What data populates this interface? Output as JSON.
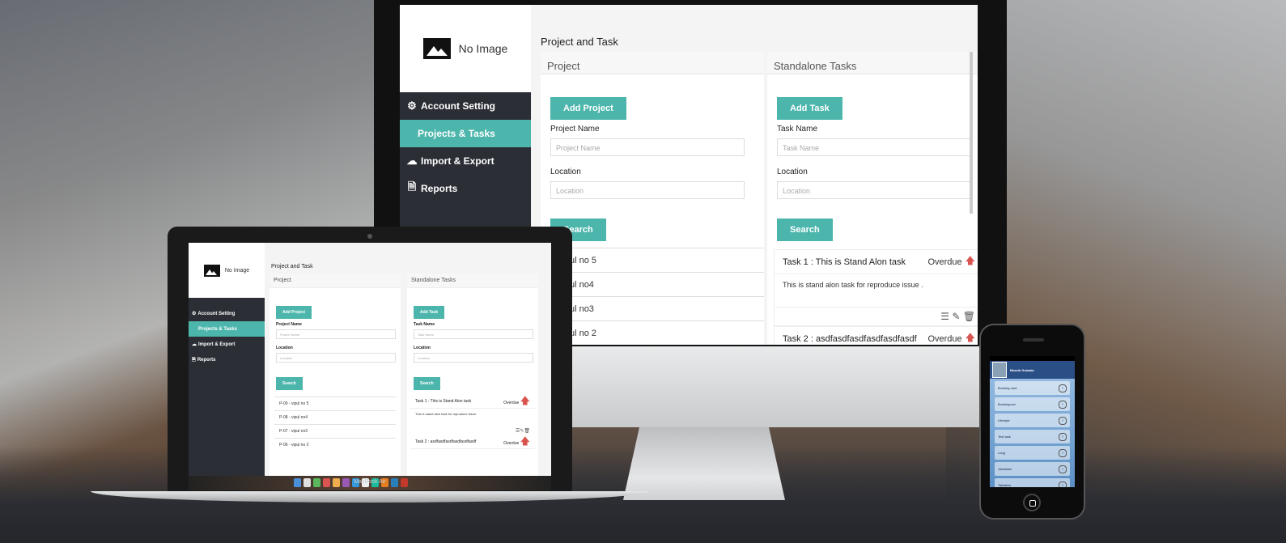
{
  "app": {
    "logo_text": "No Image",
    "page_title": "Project and Task",
    "nav": [
      {
        "label": "Account Setting",
        "icon": "gear-icon"
      },
      {
        "label": "Projects & Tasks",
        "icon": "",
        "active": true
      },
      {
        "label": "Import & Export",
        "icon": "cloud-upload-icon"
      },
      {
        "label": "Reports",
        "icon": "document-icon"
      }
    ],
    "project_panel": {
      "title": "Project",
      "add_button": "Add Project",
      "name_label": "Project Name",
      "name_placeholder": "Project Name",
      "location_label": "Location",
      "location_placeholder": "Location",
      "search_button": "Search",
      "rows": [
        "9 - vipul no 5",
        "8 - vipul no4",
        "7 - vipul no3",
        "6 - vipul no 2"
      ]
    },
    "task_panel": {
      "title": "Standalone Tasks",
      "add_button": "Add Task",
      "name_label": "Task Name",
      "name_placeholder": "Task Name",
      "location_label": "Location",
      "location_placeholder": "Location",
      "search_button": "Search",
      "tasks": [
        {
          "title": "Task 1 : This is Stand Alon task",
          "status": "Overdue",
          "body": "This is stand alon task for reproduce issue ."
        },
        {
          "title": "Task 2 : asdfasdfasdfasdfasdfasdf",
          "status": "Overdue",
          "body": ""
        }
      ]
    }
  },
  "laptop": {
    "label": "MacBook Air",
    "project_rows": [
      "P-09 - vipul no 5",
      "P-08 - vipul no4",
      "P-07 - vipul no3",
      "P-06 - vipul no 2"
    ],
    "task_titles": [
      "Task 1 : This is Stand Alon task",
      "Task 2 : asdfasdfasdfasdfasdfasdf"
    ],
    "task_body": "This is stand alon task for reproduce issue."
  },
  "phone": {
    "user_name": "Bhavik Golwala",
    "rows": [
      "Booking card",
      "Bookingnow",
      "Lifestyle",
      "Test task",
      "Long",
      "Jobstatus",
      "Tattatehs"
    ]
  },
  "colors": {
    "accent": "#4db6ac",
    "sidebar": "#2b2e35",
    "overdue_arrow": "#d9534f"
  }
}
